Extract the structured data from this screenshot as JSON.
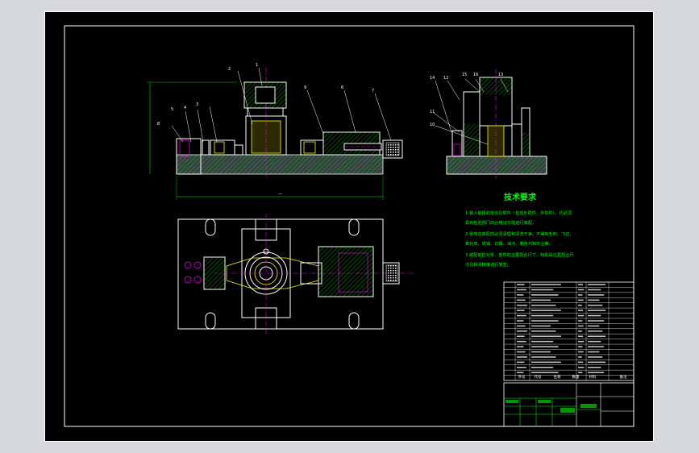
{
  "drawing": {
    "tech_requirements": {
      "title": "技术要求",
      "lines": [
        "1.装入前组的零件及附件（包括外购件、外协件），均必须",
        "具有检验部门的合格证方能进行装配。",
        "2.零件在装配前必须清理和清洗干净，不得有毛刺、飞边、",
        "氧化皮、锈蚀、切屑、油污、着色剂和灰尘等。",
        "3.装配前应对零、部件的主要配合尺寸，特别是过盈配合尺",
        "寸及相关精度进行复查。"
      ]
    },
    "balloons_front": [
      "8",
      "5",
      "4",
      "3",
      "2",
      "1",
      "9",
      "6",
      "7"
    ],
    "balloons_side": [
      "14",
      "12",
      "15",
      "16",
      "13",
      "11",
      "10"
    ],
    "bom_header": [
      "序号",
      "代号",
      "名称",
      "数量",
      "材料",
      "备注"
    ],
    "accent_green": "#00ff00",
    "accent_yellow": "#ffff00",
    "accent_magenta": "#ff00ff"
  }
}
